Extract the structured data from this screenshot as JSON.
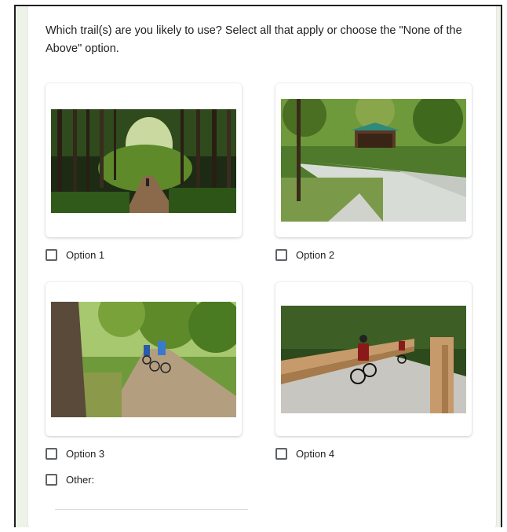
{
  "question": {
    "text": "Which trail(s) are you likely to use? Select all that apply or choose the \"None of the Above\" option."
  },
  "options": [
    {
      "label": "Option 1",
      "image": "forest-dirt-trail-photo",
      "checked": false
    },
    {
      "label": "Option 2",
      "image": "paved-trail-pavilion-photo",
      "checked": false
    },
    {
      "label": "Option 3",
      "image": "gravel-trail-cyclists-photo",
      "checked": false
    },
    {
      "label": "Option 4",
      "image": "boardwalk-cyclists-photo",
      "checked": false
    }
  ],
  "other": {
    "label": "Other:",
    "checked": false,
    "value": ""
  },
  "colors": {
    "page_background": "#eef3ea",
    "card_background": "#ffffff",
    "checkbox_border": "#5f6368",
    "text": "#202124"
  }
}
